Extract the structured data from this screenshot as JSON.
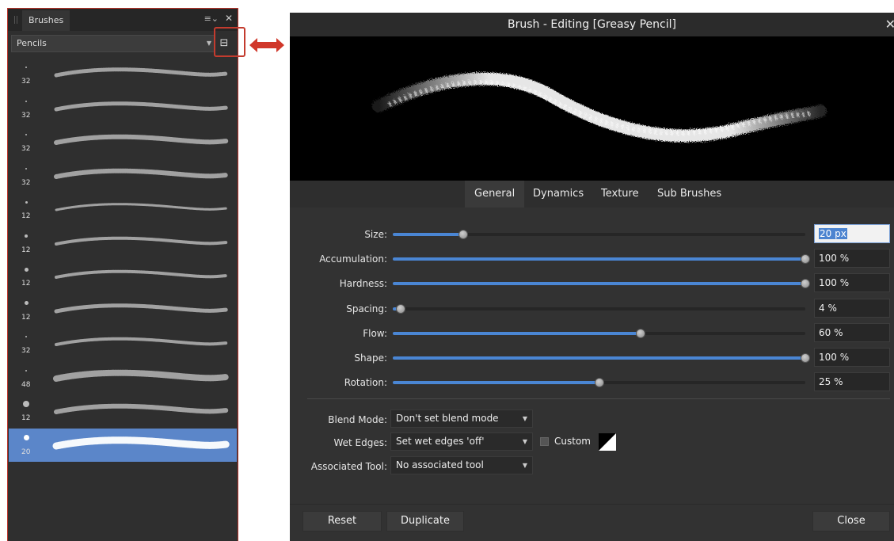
{
  "brushes_panel": {
    "tab_label": "Brushes",
    "menu_icon": "panel-menu-icon",
    "close_icon": "close-icon",
    "category": "Pencils",
    "view_toggle_icon": "list-view-icon",
    "brushes": [
      {
        "size": "32",
        "selected": false
      },
      {
        "size": "32",
        "selected": false
      },
      {
        "size": "32",
        "selected": false
      },
      {
        "size": "32",
        "selected": false
      },
      {
        "size": "12",
        "selected": false
      },
      {
        "size": "12",
        "selected": false
      },
      {
        "size": "12",
        "selected": false
      },
      {
        "size": "12",
        "selected": false
      },
      {
        "size": "32",
        "selected": false
      },
      {
        "size": "48",
        "selected": false
      },
      {
        "size": "12",
        "selected": false
      },
      {
        "size": "20",
        "selected": true
      }
    ]
  },
  "annotation": {
    "highlight_color": "#c33b2e",
    "arrow_icon": "double-arrow-icon"
  },
  "dialog": {
    "title": "Brush - Editing [Greasy Pencil]",
    "close_icon": "close-icon",
    "tabs": [
      {
        "label": "General",
        "active": true
      },
      {
        "label": "Dynamics",
        "active": false
      },
      {
        "label": "Texture",
        "active": false
      },
      {
        "label": "Sub Brushes",
        "active": false
      }
    ],
    "sliders": [
      {
        "label": "Size:",
        "value": "20 px",
        "fraction": 0.17,
        "editing": true
      },
      {
        "label": "Accumulation:",
        "value": "100 %",
        "fraction": 1.0,
        "editing": false
      },
      {
        "label": "Hardness:",
        "value": "100 %",
        "fraction": 1.0,
        "editing": false
      },
      {
        "label": "Spacing:",
        "value": "4 %",
        "fraction": 0.02,
        "editing": false
      },
      {
        "label": "Flow:",
        "value": "60 %",
        "fraction": 0.6,
        "editing": false
      },
      {
        "label": "Shape:",
        "value": "100 %",
        "fraction": 1.0,
        "editing": false
      },
      {
        "label": "Rotation:",
        "value": "25 %",
        "fraction": 0.5,
        "editing": false
      }
    ],
    "blend_mode": {
      "label": "Blend Mode:",
      "value": "Don't set blend mode"
    },
    "wet_edges": {
      "label": "Wet Edges:",
      "value": "Set wet edges 'off'",
      "custom_label": "Custom"
    },
    "associated_tool": {
      "label": "Associated Tool:",
      "value": "No associated tool"
    },
    "buttons": {
      "reset": "Reset",
      "duplicate": "Duplicate",
      "close": "Close"
    },
    "accent_color": "#4a86d4"
  }
}
